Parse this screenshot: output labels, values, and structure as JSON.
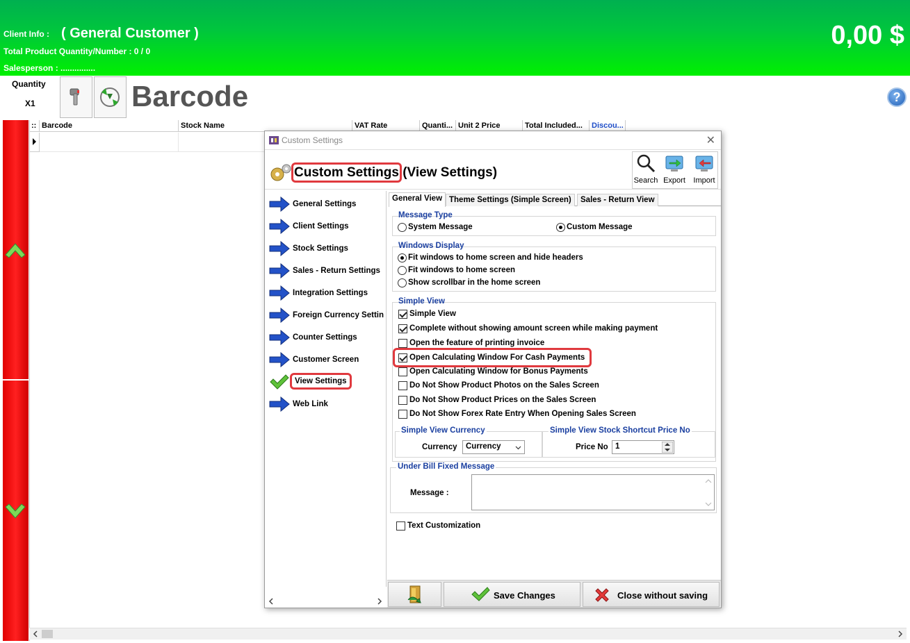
{
  "header": {
    "client_info_label": "Client Info :",
    "client_name": "( General Customer )",
    "quantity_line": "Total Product Quantity/Number :  0  /  0",
    "salesperson_line": "Salesperson :  ...............",
    "total_amount": "0,00 $"
  },
  "toolbar": {
    "quantity_label": "Quantity",
    "quantity_value": "X1",
    "title": "Barcode",
    "help_glyph": "?"
  },
  "grid": {
    "columns": [
      "Barcode",
      "Stock Name",
      "VAT Rate",
      "Quanti...",
      "Unit 2 Price",
      "Total Included...",
      "Discou..."
    ]
  },
  "dialog": {
    "window_title": "Custom Settings",
    "close_glyph": "✕",
    "heading_main": "Custom Settings",
    "heading_sub": " (View Settings)",
    "header_buttons": {
      "search": "Search",
      "export": "Export",
      "import": "Import"
    },
    "nav_items": [
      "General Settings",
      "Client Settings",
      "Stock Settings",
      "Sales - Return Settings",
      "Integration Settings",
      "Foreign Currency Settin",
      "Counter Settings",
      "Customer Screen",
      "View Settings",
      "Web Link"
    ],
    "tabs": [
      "General View",
      "Theme Settings (Simple Screen)",
      "Sales - Return View"
    ],
    "message_type": {
      "title": "Message Type",
      "options": [
        "System Message",
        "Custom Message"
      ],
      "selected": "Custom Message"
    },
    "windows_display": {
      "title": "Windows Display",
      "options": [
        "Fit windows to home screen and hide headers",
        "Fit windows to home screen",
        "Show scrollbar in the home screen"
      ],
      "selected": "Fit windows to home screen and hide headers"
    },
    "simple_view": {
      "title": "Simple View",
      "items": [
        {
          "label": "Simple View",
          "checked": true
        },
        {
          "label": "Complete without showing amount screen while making payment",
          "checked": true
        },
        {
          "label": "Open the feature of printing invoice",
          "checked": false
        },
        {
          "label": "Open Calculating Window For Cash Payments",
          "checked": true
        },
        {
          "label": "Open Calculating Window for Bonus Payments",
          "checked": false
        },
        {
          "label": "Do Not Show Product Photos on the Sales Screen",
          "checked": false
        },
        {
          "label": "Do Not Show Product Prices on the Sales Screen",
          "checked": false
        },
        {
          "label": "Do Not Show Forex Rate Entry When Opening Sales Screen",
          "checked": false
        }
      ]
    },
    "currency_group": {
      "title": "Simple View Currency",
      "label": "Currency",
      "value": "Currency"
    },
    "price_group": {
      "title": "Simple View Stock Shortcut Price No",
      "label": "Price No",
      "value": "1"
    },
    "under_bill": {
      "title": "Under Bill Fixed Message",
      "label": "Message :",
      "value": ""
    },
    "text_customization": {
      "label": "Text Customization",
      "checked": false
    },
    "footer": {
      "save": "Save Changes",
      "close": "Close without saving"
    }
  }
}
